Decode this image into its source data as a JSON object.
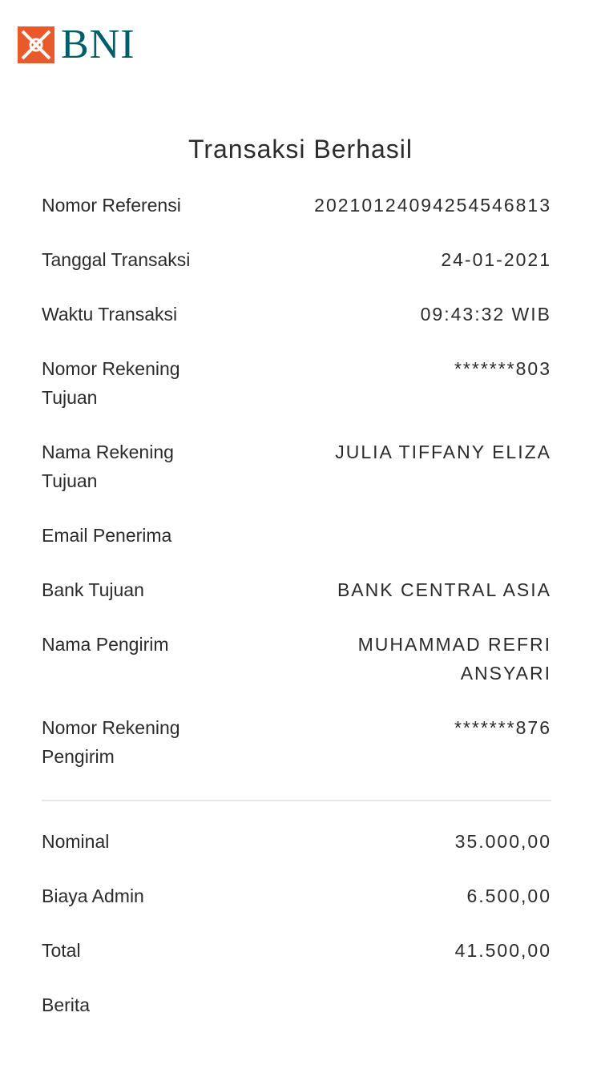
{
  "brand": {
    "logo_text": "BNI",
    "colors": {
      "orange": "#e8592b",
      "teal": "#005e6a"
    }
  },
  "title": "Transaksi Berhasil",
  "details": [
    {
      "label": "Nomor Referensi",
      "value": "20210124094254546813"
    },
    {
      "label": "Tanggal Transaksi",
      "value": "24-01-2021"
    },
    {
      "label": "Waktu Transaksi",
      "value": "09:43:32 WIB"
    },
    {
      "label": "Nomor Rekening Tujuan",
      "value": "*******803"
    },
    {
      "label": "Nama Rekening Tujuan",
      "value": "JULIA TIFFANY ELIZA"
    },
    {
      "label": "Email Penerima",
      "value": ""
    },
    {
      "label": "Bank Tujuan",
      "value": "BANK CENTRAL ASIA"
    },
    {
      "label": "Nama Pengirim",
      "value": "MUHAMMAD REFRI ANSYARI"
    },
    {
      "label": "Nomor Rekening Pengirim",
      "value": "*******876"
    }
  ],
  "amounts": [
    {
      "label": "Nominal",
      "value": "35.000,00"
    },
    {
      "label": "Biaya Admin",
      "value": "6.500,00"
    },
    {
      "label": "Total",
      "value": "41.500,00"
    },
    {
      "label": "Berita",
      "value": ""
    }
  ]
}
